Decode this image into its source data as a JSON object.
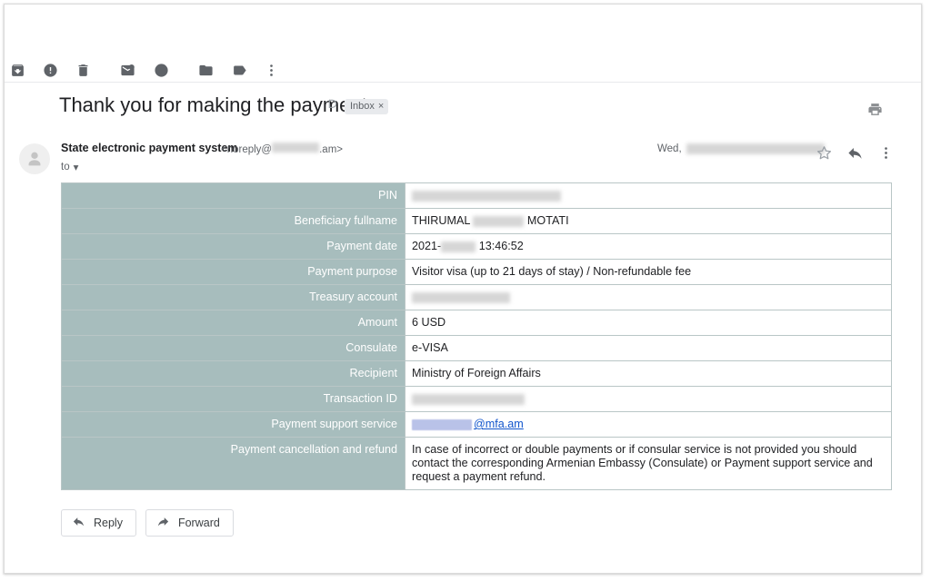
{
  "toolbar": {
    "buttons": [
      {
        "name": "archive-icon",
        "title": "Archive"
      },
      {
        "name": "report-spam-icon",
        "title": "Report spam"
      },
      {
        "name": "delete-icon",
        "title": "Delete"
      },
      {
        "name": "mark-unread-icon",
        "title": "Mark as unread"
      },
      {
        "name": "snooze-icon",
        "title": "Snooze"
      },
      {
        "name": "move-to-folder-icon",
        "title": "Move to"
      },
      {
        "name": "labels-icon",
        "title": "Labels"
      },
      {
        "name": "more-options-icon",
        "title": "More"
      }
    ]
  },
  "subject": {
    "title": "Thank you for making the payment",
    "inbox_chip_label": "Inbox",
    "inbox_chip_close": "×",
    "print_title": "Print all"
  },
  "sender": {
    "name": "State electronic payment system",
    "email_prefix": "<noreply@",
    "email_suffix": ".am>",
    "to_label": "to",
    "to_caret": "▾",
    "date_prefix": "Wed,"
  },
  "message": {
    "rows": [
      {
        "label": "PIN",
        "value": "",
        "redacted": true,
        "redact_width": 164
      },
      {
        "label": "Beneficiary fullname",
        "value_before": "THIRUMAL ",
        "value_after": " MOTATI",
        "redacted_inline": true,
        "redact_width": 56
      },
      {
        "label": "Payment date",
        "value_before": "2021-",
        "value_after": " 13:46:52",
        "redacted_inline": true,
        "redact_width": 38
      },
      {
        "label": "Payment purpose",
        "value": "Visitor visa (up to 21 days of stay) / Non-refundable fee"
      },
      {
        "label": "Treasury account",
        "value": "",
        "redacted": true,
        "redact_width": 108
      },
      {
        "label": "Amount",
        "value": "6 USD"
      },
      {
        "label": "Consulate",
        "value": "e-VISA"
      },
      {
        "label": "Recipient",
        "value": "Ministry of Foreign Affairs"
      },
      {
        "label": "Transaction ID",
        "value": "",
        "redacted": true,
        "redact_width": 124
      },
      {
        "label": "Payment support service",
        "value": "@mfa.am",
        "is_link": true
      },
      {
        "label": "Payment cancellation and refund",
        "value": "In case of incorrect or double payments or if consular service is not provided you should contact the corresponding Armenian Embassy (Consulate) or Payment support service and request a payment refund."
      }
    ]
  },
  "actions": {
    "reply_label": "Reply",
    "forward_label": "Forward"
  },
  "colors": {
    "label_cell_bg": "#a7bdbd",
    "label_cell_text": "#ffffff",
    "link": "#1155cc",
    "body_text": "#202124",
    "muted_text": "#5f6368"
  }
}
